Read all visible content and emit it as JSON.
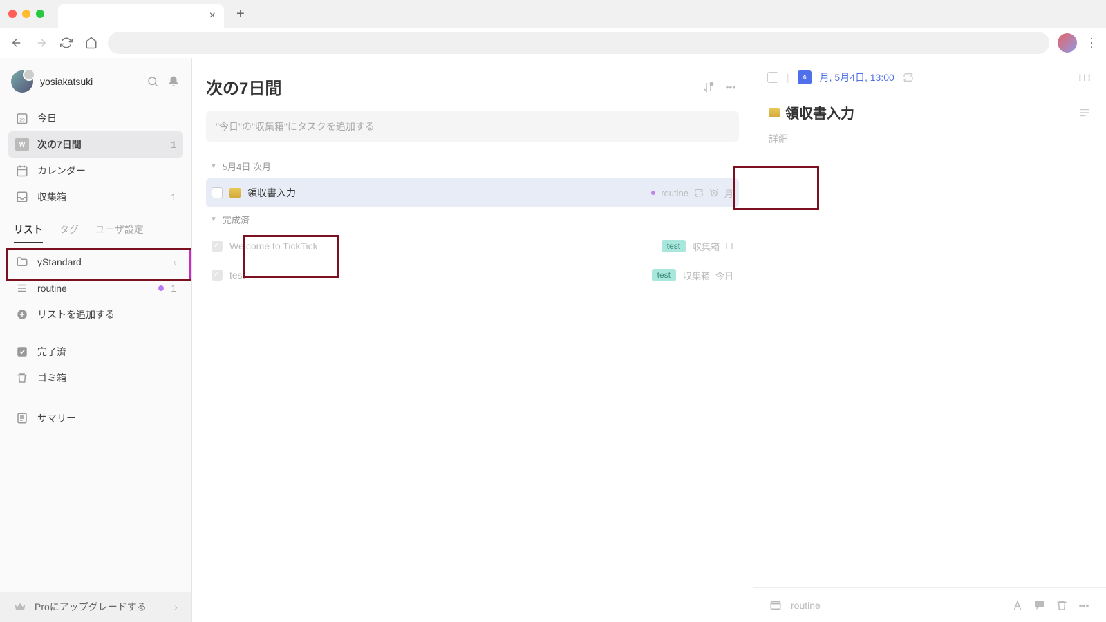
{
  "sidebar": {
    "username": "yosiakatsuki",
    "smart": {
      "today": "今日",
      "next7": "次の7日間",
      "next7_count": "1",
      "calendar": "カレンダー",
      "inbox": "収集箱",
      "inbox_count": "1"
    },
    "tabs": {
      "list": "リスト",
      "tag": "タグ",
      "user": "ユーザ設定"
    },
    "lists": {
      "ystandard": "yStandard",
      "routine": "routine",
      "routine_count": "1",
      "add": "リストを追加する"
    },
    "bottom": {
      "completed": "完了済",
      "trash": "ゴミ箱",
      "summary": "サマリー"
    },
    "upgrade": "Proにアップグレードする"
  },
  "main": {
    "title": "次の7日間",
    "add_placeholder": "\"今日\"の\"収集箱\"にタスクを追加する",
    "section1": "5月4日 次月",
    "task1": {
      "title": "領収書入力",
      "tag": "routine",
      "date": "月"
    },
    "section2": "完成済",
    "task2": {
      "title": "Welcome to TickTick",
      "tag": "test",
      "list": "収集箱"
    },
    "task3": {
      "title": "test",
      "tag": "test",
      "list": "収集箱",
      "date": "今日"
    }
  },
  "detail": {
    "date_num": "4",
    "date_text": "月, 5月4日, 13:00",
    "title": "領収書入力",
    "desc": "詳細",
    "footer_list": "routine"
  }
}
